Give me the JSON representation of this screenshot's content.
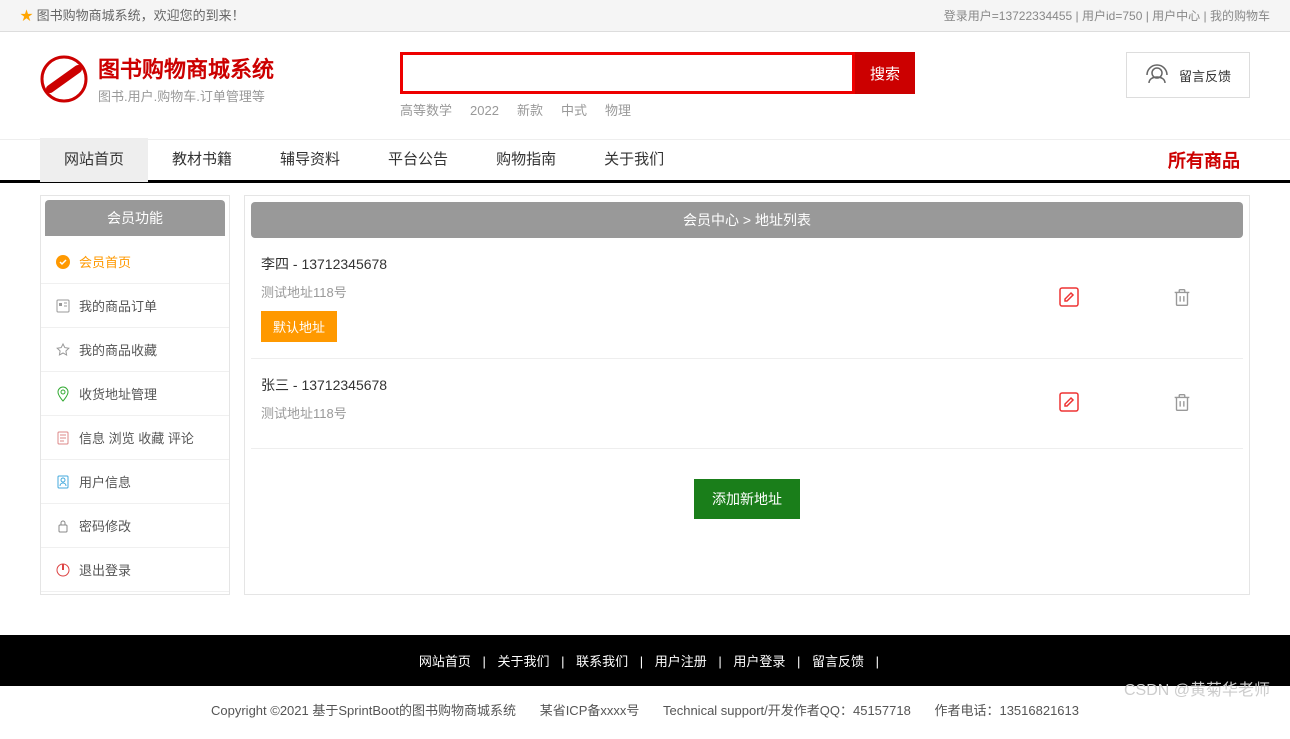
{
  "topbar": {
    "welcome": "图书购物商城系统，欢迎您的到来！",
    "login_user": "登录用户=13722334455",
    "user_id": "用户id=750",
    "user_center": "用户中心",
    "my_cart": "我的购物车"
  },
  "logo": {
    "title": "图书购物商城系统",
    "subtitle": "图书.用户.购物车.订单管理等"
  },
  "search": {
    "button": "搜索",
    "placeholder": "",
    "hotwords": [
      "高等数学",
      "2022",
      "新款",
      "中式",
      "物理"
    ]
  },
  "feedback": {
    "label": "留言反馈"
  },
  "nav": {
    "items": [
      "网站首页",
      "教材书籍",
      "辅导资料",
      "平台公告",
      "购物指南",
      "关于我们"
    ],
    "right": "所有商品"
  },
  "sidebar": {
    "header": "会员功能",
    "items": [
      {
        "label": "会员首页",
        "icon": "home"
      },
      {
        "label": "我的商品订单",
        "icon": "order"
      },
      {
        "label": "我的商品收藏",
        "icon": "star"
      },
      {
        "label": "收货地址管理",
        "icon": "location"
      },
      {
        "label": "信息 浏览 收藏 评论",
        "icon": "doc"
      },
      {
        "label": "用户信息",
        "icon": "user"
      },
      {
        "label": "密码修改",
        "icon": "lock"
      },
      {
        "label": "退出登录",
        "icon": "logout"
      }
    ]
  },
  "content": {
    "breadcrumb": "会员中心 > 地址列表",
    "addresses": [
      {
        "name": "李四 - 13712345678",
        "detail": "测试地址118号",
        "default": true,
        "badge": "默认地址"
      },
      {
        "name": "张三 - 13712345678",
        "detail": "测试地址118号",
        "default": false,
        "badge": ""
      }
    ],
    "add_button": "添加新地址"
  },
  "footer": {
    "links": [
      "网站首页",
      "关于我们",
      "联系我们",
      "用户注册",
      "用户登录",
      "留言反馈"
    ],
    "copyright": "Copyright ©2021 基于SprintBoot的图书购物商城系统",
    "icp": "某省ICP备xxxx号",
    "tech": "Technical support/开发作者QQ：45157718",
    "phone": "作者电话：13516821613"
  },
  "watermark": "CSDN @黄菊华老师"
}
